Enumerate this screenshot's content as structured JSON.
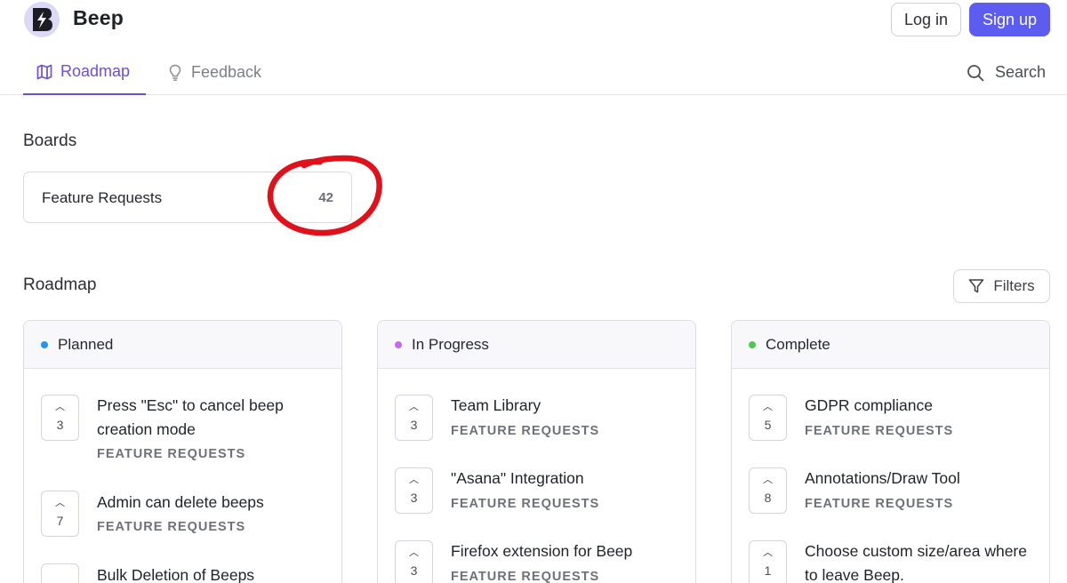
{
  "header": {
    "brand": "Beep",
    "login_label": "Log in",
    "signup_label": "Sign up",
    "accent_color": "#5c5cf0"
  },
  "nav": {
    "tabs": [
      {
        "label": "Roadmap",
        "icon": "map-icon",
        "active": true
      },
      {
        "label": "Feedback",
        "icon": "lightbulb-icon",
        "active": false
      }
    ],
    "search_label": "Search"
  },
  "boards": {
    "title": "Boards",
    "items": [
      {
        "name": "Feature Requests",
        "count": "42"
      }
    ]
  },
  "roadmap": {
    "title": "Roadmap",
    "filters_label": "Filters",
    "columns": [
      {
        "label": "Planned",
        "dot_color": "#2196f3",
        "items": [
          {
            "votes": "3",
            "title": "Press \"Esc\" to cancel beep creation mode",
            "tag": "FEATURE REQUESTS"
          },
          {
            "votes": "7",
            "title": "Admin can delete beeps",
            "tag": "FEATURE REQUESTS"
          },
          {
            "votes": "",
            "title": "Bulk Deletion of Beeps",
            "tag": ""
          }
        ]
      },
      {
        "label": "In Progress",
        "dot_color": "#c36bf0",
        "items": [
          {
            "votes": "3",
            "title": "Team Library",
            "tag": "FEATURE REQUESTS"
          },
          {
            "votes": "3",
            "title": "\"Asana\" Integration",
            "tag": "FEATURE REQUESTS"
          },
          {
            "votes": "3",
            "title": "Firefox extension for Beep",
            "tag": "FEATURE REQUESTS"
          }
        ]
      },
      {
        "label": "Complete",
        "dot_color": "#4cc94c",
        "items": [
          {
            "votes": "5",
            "title": "GDPR compliance",
            "tag": "FEATURE REQUESTS"
          },
          {
            "votes": "8",
            "title": "Annotations/Draw Tool",
            "tag": "FEATURE REQUESTS"
          },
          {
            "votes": "1",
            "title": "Choose custom size/area where to leave Beep.",
            "tag": ""
          }
        ]
      }
    ]
  }
}
